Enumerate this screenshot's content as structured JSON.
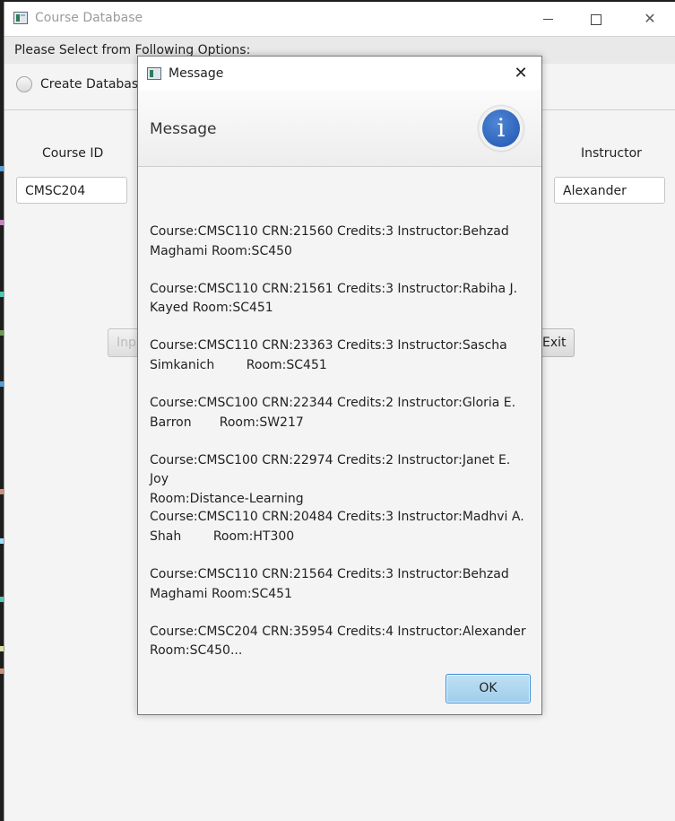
{
  "main_window": {
    "title": "Course Database",
    "options_prompt": "Please Select from Following Options:",
    "radio_label": "Create Database",
    "fields": {
      "course_id_label": "Course ID",
      "course_id_value": "CMSC204",
      "instructor_label": "Instructor",
      "instructor_value": "Alexander"
    },
    "buttons": {
      "input_partial": "Inpu",
      "exit": "Exit"
    }
  },
  "dialog": {
    "title": "Message",
    "header": "Message",
    "icon": "info-icon",
    "entries": [
      "Course:CMSC110 CRN:21560 Credits:3 Instructor:Behzad\nMaghami Room:SC450",
      "Course:CMSC110 CRN:21561 Credits:3 Instructor:Rabiha J.\nKayed Room:SC451",
      "Course:CMSC110 CRN:23363 Credits:3 Instructor:Sascha\nSimkanich        Room:SC451",
      "Course:CMSC100 CRN:22344 Credits:2 Instructor:Gloria E.\nBarron       Room:SW217",
      "Course:CMSC100 CRN:22974 Credits:2 Instructor:Janet E. Joy\nRoom:Distance-Learning",
      "Course:CMSC110 CRN:20484 Credits:3 Instructor:Madhvi A.\nShah        Room:HT300",
      "Course:CMSC110 CRN:21564 Credits:3 Instructor:Behzad\nMaghami Room:SC451",
      "Course:CMSC204 CRN:35954 Credits:4 Instructor:Alexander\nRoom:SC450..."
    ],
    "ok_label": "OK"
  }
}
